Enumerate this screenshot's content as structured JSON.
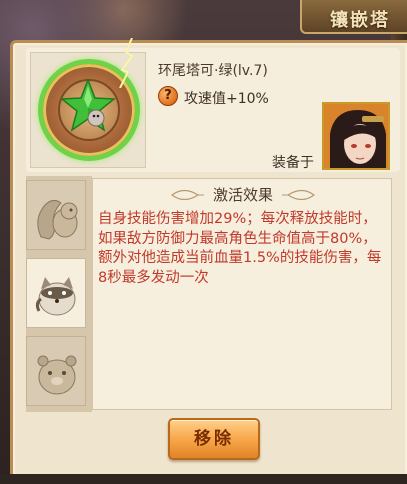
{
  "header": {
    "title": "镶嵌塔"
  },
  "item": {
    "name": "环尾塔可·绿(lv.7)",
    "stat_icon_glyph": "?",
    "stat_text": "攻速值+10%",
    "equipped_label": "装备于",
    "gem_color": "#3fbf3a"
  },
  "effect": {
    "title": "激活效果",
    "description": "自身技能伤害增加29%；每次释放技能时，如果敌方防御力最高角色生命值高于80%，额外对他造成当前血量1.5%的技能伤害，每8秒最多发动一次"
  },
  "skill_tabs": [
    {
      "name": "squirrel",
      "active": false
    },
    {
      "name": "raccoon",
      "active": true
    },
    {
      "name": "hamster",
      "active": false
    }
  ],
  "actions": {
    "remove_label": "移除"
  },
  "colors": {
    "panel": "#efe4cd",
    "description_text": "#c0392b",
    "button": "#f8a74a"
  }
}
